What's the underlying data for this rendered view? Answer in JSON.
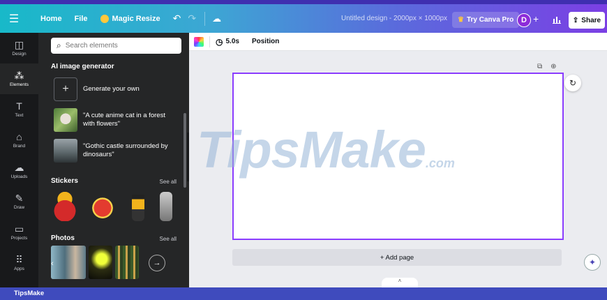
{
  "topbar": {
    "file": "File",
    "home": "Home",
    "magic_resize": "Magic Resize",
    "doc_title": "Untitled design - 2000px × 1000px",
    "try_pro": "Try Canva Pro",
    "avatar_initial": "D",
    "share": "Share"
  },
  "rail": {
    "items": [
      {
        "label": "Design",
        "icon": "layout-icon"
      },
      {
        "label": "Elements",
        "icon": "shapes-icon"
      },
      {
        "label": "Text",
        "icon": "text-icon"
      },
      {
        "label": "Brand",
        "icon": "briefcase-icon"
      },
      {
        "label": "Uploads",
        "icon": "cloud-upload-icon"
      },
      {
        "label": "Draw",
        "icon": "pen-icon"
      },
      {
        "label": "Projects",
        "icon": "folder-icon"
      },
      {
        "label": "Apps",
        "icon": "grid-icon"
      }
    ],
    "active": "Elements"
  },
  "panel": {
    "search_placeholder": "Search elements",
    "ai_title": "AI image generator",
    "ai_items": [
      {
        "label": "Generate your own"
      },
      {
        "label": "\"A cute anime cat in a forest with flowers\""
      },
      {
        "label": "\"Gothic castle surrounded by dinosaurs\""
      }
    ],
    "stickers_title": "Stickers",
    "stickers_see_all": "See all",
    "photos_title": "Photos",
    "photos_see_all": "See all"
  },
  "canvas_toolbar": {
    "duration": "5.0s",
    "position": "Position"
  },
  "workspace": {
    "add_page": "+ Add page"
  },
  "watermark": {
    "main": "TipsMake",
    "suffix": ".com"
  },
  "footer": {
    "brand": "TipsMake"
  }
}
